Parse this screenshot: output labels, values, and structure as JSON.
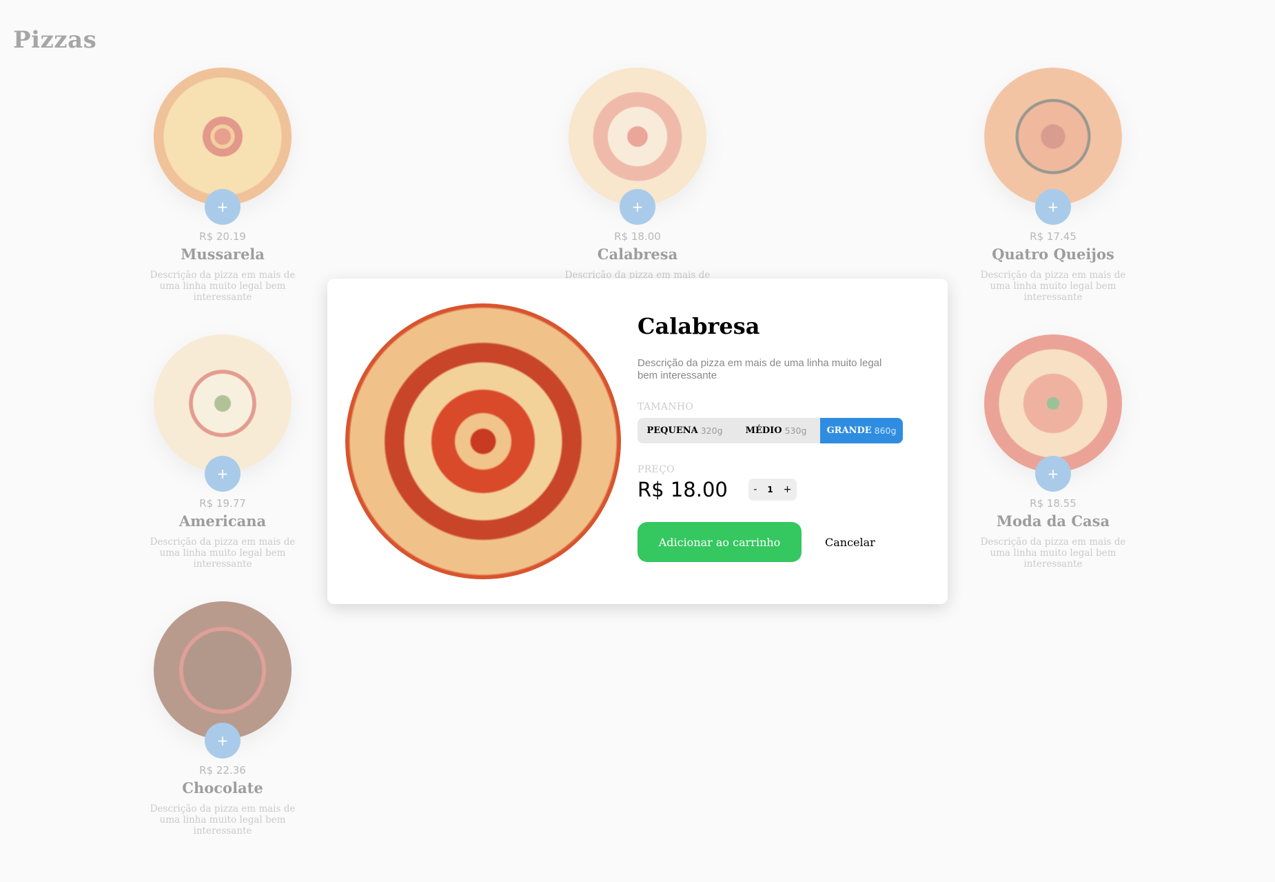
{
  "page": {
    "title": "Pizzas"
  },
  "pizzas": [
    {
      "name": "Mussarela",
      "price": "R$ 20.19",
      "desc": "Descrição da pizza em mais de uma linha muito legal bem interessante",
      "add": "+"
    },
    {
      "name": "Calabresa",
      "price": "R$ 18.00",
      "desc": "Descrição da pizza em mais de",
      "add": "+"
    },
    {
      "name": "Quatro Queijos",
      "price": "R$ 17.45",
      "desc": "Descrição da pizza em mais de uma linha muito legal bem interessante",
      "add": "+"
    },
    {
      "name": "Americana",
      "price": "R$ 19.77",
      "desc": "Descrição da pizza em mais de uma linha muito legal bem interessante",
      "add": "+"
    },
    {
      "name": "Moda da Casa",
      "price": "R$ 18.55",
      "desc": "Descrição da pizza em mais de uma linha muito legal bem interessante",
      "add": "+"
    },
    {
      "name": "Chocolate",
      "price": "R$ 22.36",
      "desc": "Descrição da pizza em mais de uma linha muito legal bem interessante",
      "add": "+"
    }
  ],
  "modal": {
    "title": "Calabresa",
    "desc": "Descrição da pizza em mais de uma linha muito legal bem interessante",
    "size_label": "TAMANHO",
    "sizes": [
      {
        "name": "PEQUENA",
        "weight": "320g",
        "selected": false
      },
      {
        "name": "MÉDIO",
        "weight": "530g",
        "selected": false
      },
      {
        "name": "GRANDE",
        "weight": "860g",
        "selected": true
      }
    ],
    "price_label": "PREÇO",
    "price": "R$ 18.00",
    "qty": {
      "minus": "-",
      "value": "1",
      "plus": "+"
    },
    "add_to_cart": "Adicionar ao carrinho",
    "cancel": "Cancelar"
  },
  "colors": {
    "accent": "#2e8de0",
    "add_button": "#5b9bd5",
    "cart_button": "#35c760"
  },
  "icons": {
    "pizza_image": "pizza-photo",
    "add": "plus-icon"
  }
}
